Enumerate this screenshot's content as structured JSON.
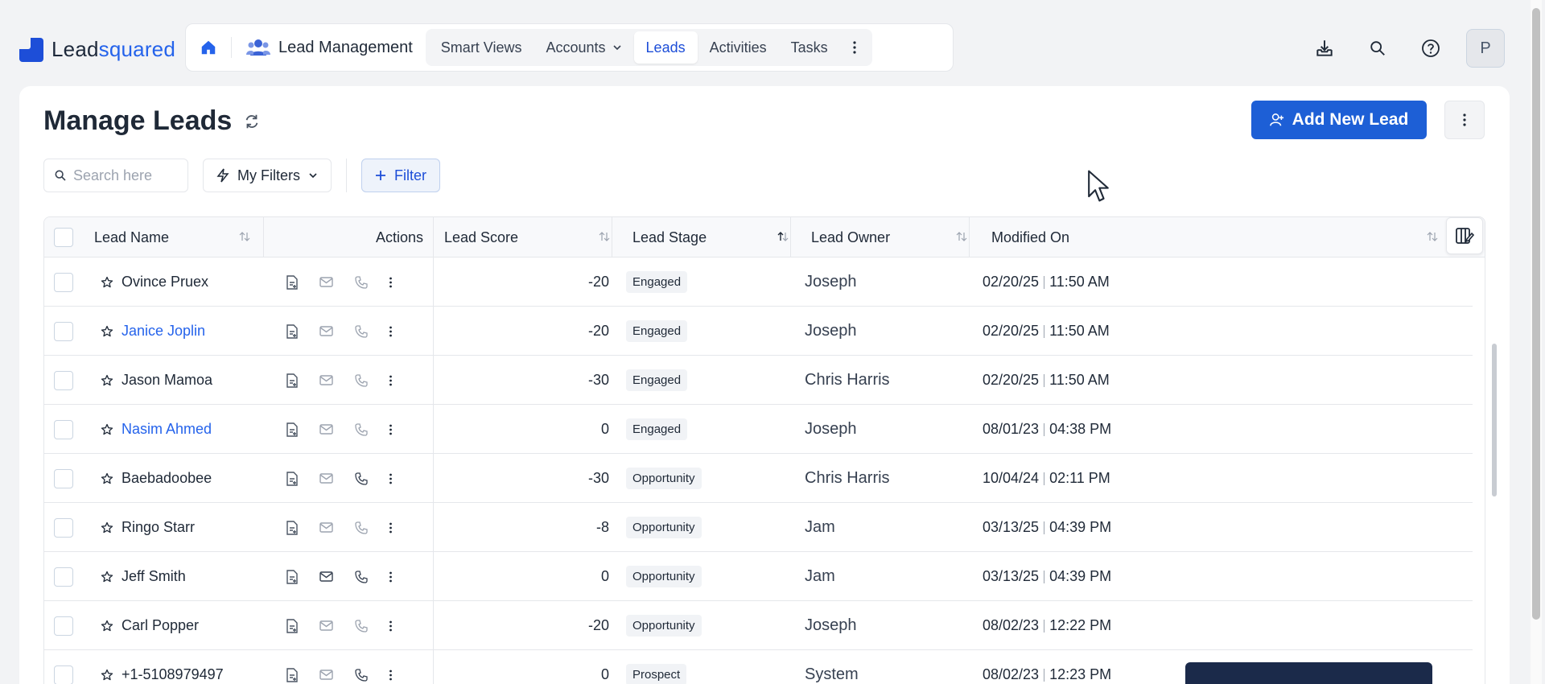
{
  "app": {
    "logo_plain": "Lead",
    "logo_brand": "squared",
    "module": "Lead Management",
    "tabs": [
      {
        "label": "Smart Views"
      },
      {
        "label": "Accounts"
      },
      {
        "label": "Leads"
      },
      {
        "label": "Activities"
      },
      {
        "label": "Tasks"
      }
    ],
    "avatar_initial": "P"
  },
  "page": {
    "title": "Manage Leads",
    "add_button": "Add New Lead"
  },
  "filters": {
    "search_placeholder": "Search here",
    "my_filters": "My Filters",
    "filter": "Filter"
  },
  "table": {
    "headers": {
      "name": "Lead Name",
      "actions": "Actions",
      "score": "Lead Score",
      "stage": "Lead Stage",
      "owner": "Lead Owner",
      "modified": "Modified On"
    },
    "rows": [
      {
        "name": "Ovince Pruex",
        "score": "-20",
        "stage": "Engaged",
        "owner": "Joseph",
        "date": "02/20/25",
        "time": "11:50 AM"
      },
      {
        "name": "Janice Joplin",
        "score": "-20",
        "stage": "Engaged",
        "owner": "Joseph",
        "date": "02/20/25",
        "time": "11:50 AM"
      },
      {
        "name": "Jason Mamoa",
        "score": "-30",
        "stage": "Engaged",
        "owner": "Chris Harris",
        "date": "02/20/25",
        "time": "11:50 AM"
      },
      {
        "name": "Nasim Ahmed",
        "score": "0",
        "stage": "Engaged",
        "owner": "Joseph",
        "date": "08/01/23",
        "time": "04:38 PM"
      },
      {
        "name": "Baebadoobee",
        "score": "-30",
        "stage": "Opportunity",
        "owner": "Chris Harris",
        "date": "10/04/24",
        "time": "02:11 PM"
      },
      {
        "name": "Ringo Starr",
        "score": "-8",
        "stage": "Opportunity",
        "owner": "Jam",
        "date": "03/13/25",
        "time": "04:39 PM"
      },
      {
        "name": "Jeff Smith",
        "score": "0",
        "stage": "Opportunity",
        "owner": "Jam",
        "date": "03/13/25",
        "time": "04:39 PM"
      },
      {
        "name": "Carl Popper",
        "score": "-20",
        "stage": "Opportunity",
        "owner": "Joseph",
        "date": "08/02/23",
        "time": "12:22 PM"
      },
      {
        "name": "+1-5108979497",
        "score": "0",
        "stage": "Prospect",
        "owner": "System",
        "date": "08/02/23",
        "time": "12:23 PM"
      }
    ]
  }
}
